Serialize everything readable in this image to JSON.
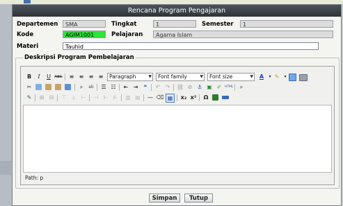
{
  "dialog": {
    "title": "Rencana Program Pengajaran"
  },
  "form": {
    "departemen_label": "Departemen",
    "departemen_value": "SMA",
    "tingkat_label": "Tingkat",
    "tingkat_value": "1",
    "semester_label": "Semester",
    "semester_value": "1",
    "kode_label": "Kode",
    "kode_value": "AGIM1001",
    "pelajaran_label": "Pelajaran",
    "pelajaran_value": "Agama Islam",
    "materi_label": "Materi",
    "materi_value": "Tauhid",
    "deskripsi_legend": "Deskripsi Program Pembelajaran"
  },
  "editor": {
    "format_select": "Paragraph",
    "font_family_select": "Font family",
    "font_size_select": "Font size",
    "status_path": "Path: p",
    "buttons": {
      "bold": "B",
      "italic": "I",
      "underline": "U",
      "strike": "ABC",
      "subscript": "x₂",
      "superscript": "x²",
      "omega": "Ω",
      "undo": "↶",
      "redo": "↷",
      "quote": "❝"
    }
  },
  "actions": {
    "save_label": "Simpan",
    "close_label": "Tutup"
  },
  "colors": {
    "titlebar": "#3a4047",
    "kode_field": "#2ee33a",
    "dialog_bg": "#f4f4f0"
  }
}
